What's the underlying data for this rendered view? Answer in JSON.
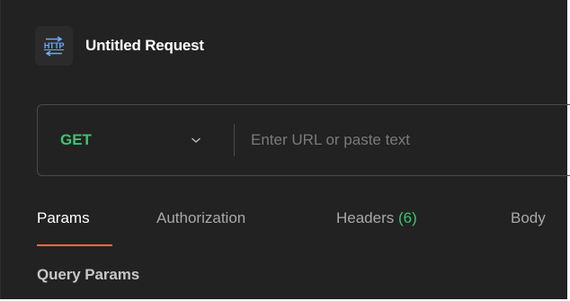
{
  "request": {
    "icon_text": "HTTP",
    "icon_name": "http-icon",
    "title": "Untitled Request"
  },
  "url_bar": {
    "method": "GET",
    "method_color": "#3fc36f",
    "placeholder": "Enter URL or paste text",
    "value": ""
  },
  "tabs": [
    {
      "label": "Params",
      "active": true
    },
    {
      "label": "Authorization",
      "active": false
    },
    {
      "label": "Headers",
      "count": "(6)",
      "active": false
    },
    {
      "label": "Body",
      "active": false
    }
  ],
  "accent_color": "#ff6c37",
  "section": {
    "label": "Query Params"
  }
}
